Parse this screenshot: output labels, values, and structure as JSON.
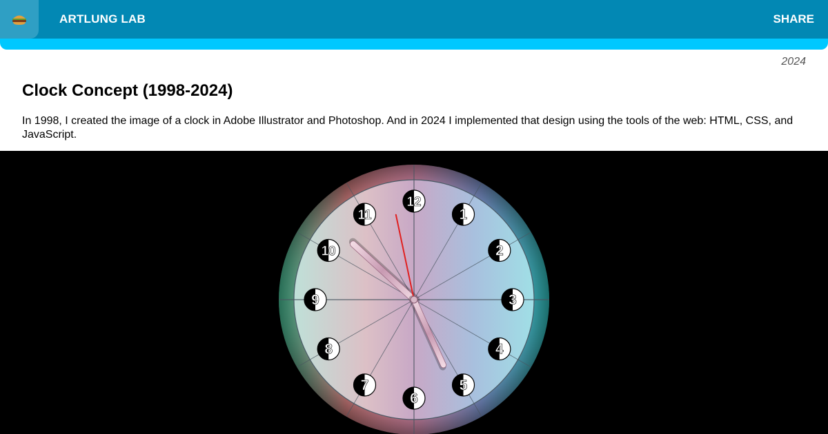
{
  "header": {
    "menu_icon": "hamburger-icon",
    "brand": "ARTLUNG LAB",
    "share_label": "SHARE"
  },
  "article": {
    "date": "2024",
    "title": "Clock Concept (1998-2024)",
    "description": "In 1998, I created the image of a clock in Adobe Illustrator and Photoshop. And in 2024 I implemented that design using the tools of the web: HTML, CSS, and JavaScript."
  },
  "clock": {
    "numerals": [
      "12",
      "1",
      "2",
      "3",
      "4",
      "5",
      "6",
      "7",
      "8",
      "9",
      "10",
      "11"
    ],
    "hours": 10,
    "minutes": 25,
    "seconds": 58,
    "colors": {
      "second_hand": "#e02020",
      "background": "#000000",
      "header": "#0288b4",
      "header_accent": "#00c8ff"
    }
  }
}
